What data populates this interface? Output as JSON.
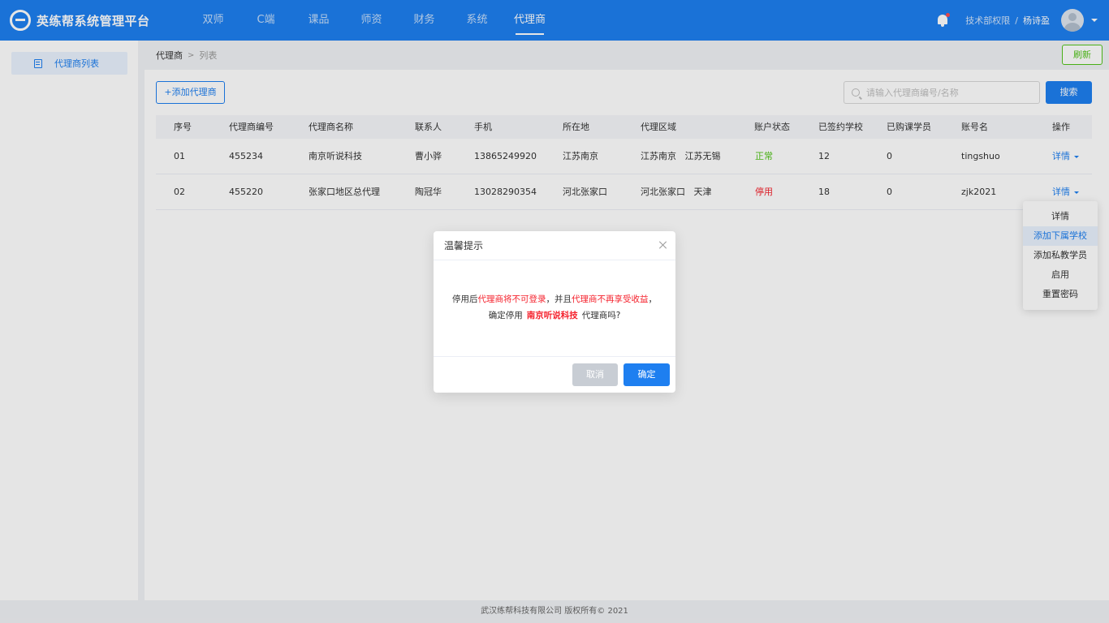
{
  "app": {
    "title": "英练帮系统管理平台"
  },
  "nav": {
    "items": [
      {
        "label": "双师"
      },
      {
        "label": "C端"
      },
      {
        "label": "课品"
      },
      {
        "label": "师资"
      },
      {
        "label": "财务"
      },
      {
        "label": "系统"
      },
      {
        "label": "代理商"
      }
    ],
    "active": "代理商"
  },
  "user": {
    "dept": "技术部权限",
    "separator": "/",
    "name": "杨诗盈"
  },
  "sidebar": {
    "items": [
      {
        "label": "代理商列表",
        "icon": "list-icon"
      }
    ]
  },
  "breadcrumb": {
    "parent": "代理商",
    "separator": ">",
    "current": "列表"
  },
  "toolbar": {
    "refresh_label": "刷新",
    "add_label": "+添加代理商",
    "search_placeholder": "请输入代理商编号/名称",
    "search_label": "搜索"
  },
  "table": {
    "columns": [
      "序号",
      "代理商编号",
      "代理商名称",
      "联系人",
      "手机",
      "所在地",
      "代理区域",
      "账户状态",
      "已签约学校",
      "已购课学员",
      "账号名",
      "操作"
    ],
    "rows": [
      {
        "no": "01",
        "code": "455234",
        "name": "南京听说科技",
        "contact": "曹小骅",
        "phone": "13865249920",
        "location": "江苏南京",
        "region": "江苏南京   江苏无锡",
        "status": "正常",
        "schools": "12",
        "students": "0",
        "account": "tingshuo",
        "op": "详情"
      },
      {
        "no": "02",
        "code": "455220",
        "name": "张家口地区总代理",
        "contact": "陶冠华",
        "phone": "13028290354",
        "location": "河北张家口",
        "region": "河北张家口   天津",
        "status": "停用",
        "schools": "18",
        "students": "0",
        "account": "zjk2021",
        "op": "详情"
      }
    ]
  },
  "dropdown": {
    "items": [
      "详情",
      "添加下属学校",
      "添加私教学员",
      "启用",
      "重置密码"
    ],
    "hovered": "添加下属学校"
  },
  "modal": {
    "title": "温馨提示",
    "line1": {
      "a": "停用后",
      "b": "代理商将不可登录",
      "c": "，并且",
      "d": "代理商不再享受收益",
      "e": "，"
    },
    "line2": {
      "a": "确定停用",
      "b": "南京听说科技",
      "c": "代理商吗?"
    },
    "cancel_label": "取消",
    "ok_label": "确定"
  },
  "footer": {
    "text": "武汉练帮科技有限公司 版权所有© 2021"
  },
  "colors": {
    "primary": "#1e7ff0",
    "success": "#52c41a",
    "danger": "#f5222d"
  }
}
